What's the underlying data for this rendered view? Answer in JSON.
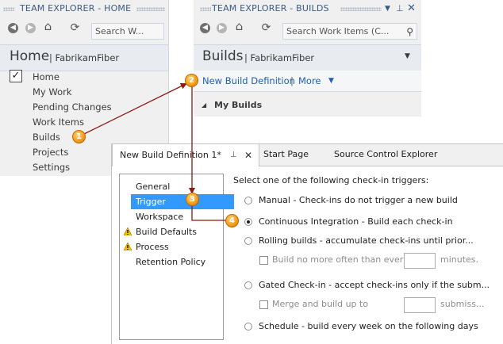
{
  "panel1": {
    "title": "TEAM EXPLORER - HOME",
    "search_placeholder": "Search W...",
    "header_title": "Home",
    "header_subtitle": "| FabrikamFiber",
    "nav": [
      "Home",
      "My Work",
      "Pending Changes",
      "Work Items",
      "Builds",
      "Projects",
      "Settings"
    ]
  },
  "panel2": {
    "title": "TEAM EXPLORER - BUILDS",
    "search_placeholder": "Search Work Items (C...",
    "header_title": "Builds",
    "header_subtitle": "| FabrikamFiber",
    "new_build_link": "New Build Definition",
    "separator": "|",
    "more_link": "More",
    "section_title": "My Builds"
  },
  "editor": {
    "tabs": {
      "active": "New Build Definition 1*",
      "start_page": "Start Page",
      "source_control": "Source Control Explorer"
    },
    "sections": [
      "General",
      "Trigger",
      "Workspace",
      "Build Defaults",
      "Process",
      "Retention Policy"
    ],
    "selected_section": "Trigger",
    "instruction": "Select one of the following check-in triggers:",
    "triggers": {
      "manual": "Manual - Check-ins do not trigger a new build",
      "ci": "Continuous Integration - Build each check-in",
      "rolling": "Rolling builds - accumulate check-ins until prior...",
      "rolling_limit": "Build no more often than every",
      "rolling_unit": "minutes.",
      "gated": "Gated Check-in - accept check-ins only if the subm...",
      "gated_merge": "Merge and build up to",
      "gated_unit": "submiss...",
      "schedule": "Schedule - build every week on the following days"
    },
    "selected_trigger": "ci"
  },
  "callouts": [
    "1",
    "2",
    "3",
    "4"
  ],
  "colors": {
    "accent": "#3399ff",
    "title_text": "#3b5a82",
    "callout": "#f4a020",
    "arrow": "#8b1a10",
    "link": "#1e5fb4",
    "warning": "#f2c200"
  }
}
